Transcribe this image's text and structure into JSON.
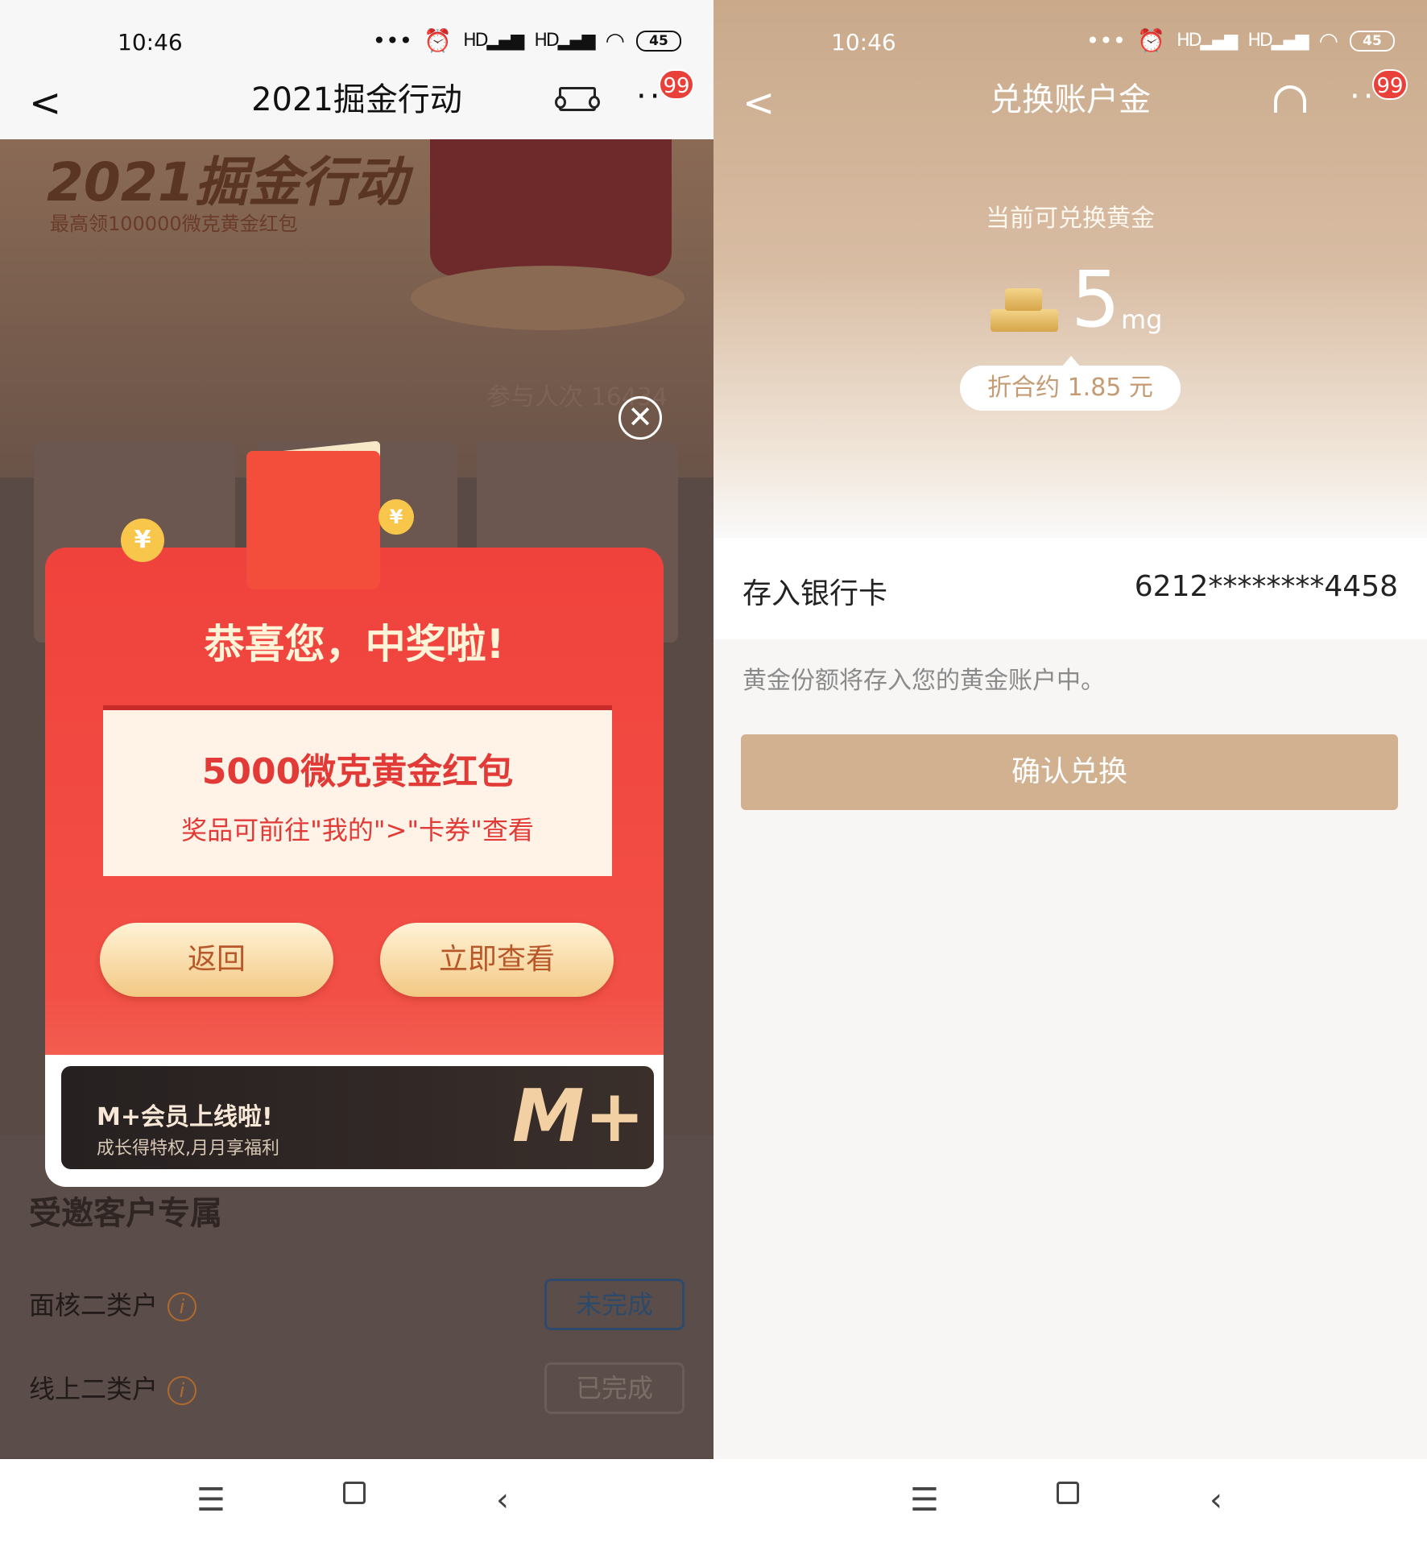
{
  "left": {
    "status": {
      "time": "10:46",
      "signal1": "HD",
      "signal2": "HD",
      "battery": "45"
    },
    "nav": {
      "back": "<",
      "title": "2021掘金行动",
      "more": "···",
      "badge": "99"
    },
    "banner": {
      "title": "2021掘金行动",
      "subtitle": "最高领100000微克黄金红包",
      "participants": "参与人次 16434"
    },
    "modal": {
      "title": "恭喜您，中奖啦!",
      "prize": "5000微克黄金红包",
      "hint": "奖品可前往\"我的\">\"卡券\"查看",
      "back_button": "返回",
      "view_button": "立即查看",
      "close": "✕"
    },
    "promo": {
      "title": "M+会员上线啦!",
      "subtitle": "成长得特权,月月享福利",
      "logo": "M+"
    },
    "invite": {
      "title": "受邀客户专属",
      "rows": [
        {
          "label": "面核二类户",
          "status": "未完成"
        },
        {
          "label": "线上二类户",
          "status": "已完成"
        }
      ]
    },
    "coin_symbol": "¥"
  },
  "right": {
    "status": {
      "time": "10:46",
      "signal1": "HD",
      "signal2": "HD",
      "battery": "45"
    },
    "nav": {
      "back": "<",
      "title": "兑换账户金",
      "more": "···",
      "badge": "99"
    },
    "gold": {
      "label": "当前可兑换黄金",
      "amount": "5",
      "unit": "mg",
      "approx": "折合约 1.85 元"
    },
    "card": {
      "label": "存入银行卡",
      "value": "6212********4458"
    },
    "note": "黄金份额将存入您的黄金账户中。",
    "confirm": "确认兑换"
  },
  "sysnav": {
    "menu": "☰",
    "back": "‹"
  },
  "colors": {
    "modal_red": "#f0423c",
    "gold_tan": "#d1b18f",
    "badge_red": "#e9403a"
  }
}
